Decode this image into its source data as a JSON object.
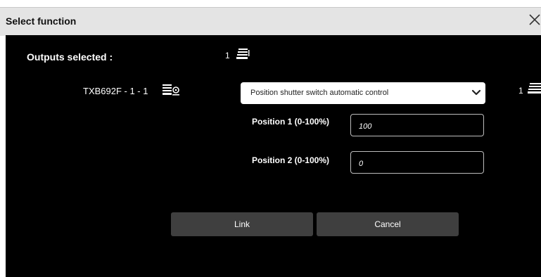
{
  "dialog": {
    "title": "Select function",
    "close_icon": "close-icon"
  },
  "outputs": {
    "label": "Outputs selected :",
    "count": "1",
    "icon": "outputs-stack-icon"
  },
  "device": {
    "label": "TXB692F - 1 - 1",
    "icon": "device-settings-icon",
    "function_select": "Position shutter switch automatic control",
    "select_icon": "chevron-down-icon",
    "right_count": "1"
  },
  "fields": [
    {
      "label": "Position 1 (0-100%)",
      "value": "100"
    },
    {
      "label": "Position 2 (0-100%)",
      "value": "0"
    }
  ],
  "buttons": {
    "link": "Link",
    "cancel": "Cancel"
  },
  "colors": {
    "panel_background": "#000000",
    "titlebar_background": "#e4e4e4",
    "button_background": "#3f3f3f"
  }
}
